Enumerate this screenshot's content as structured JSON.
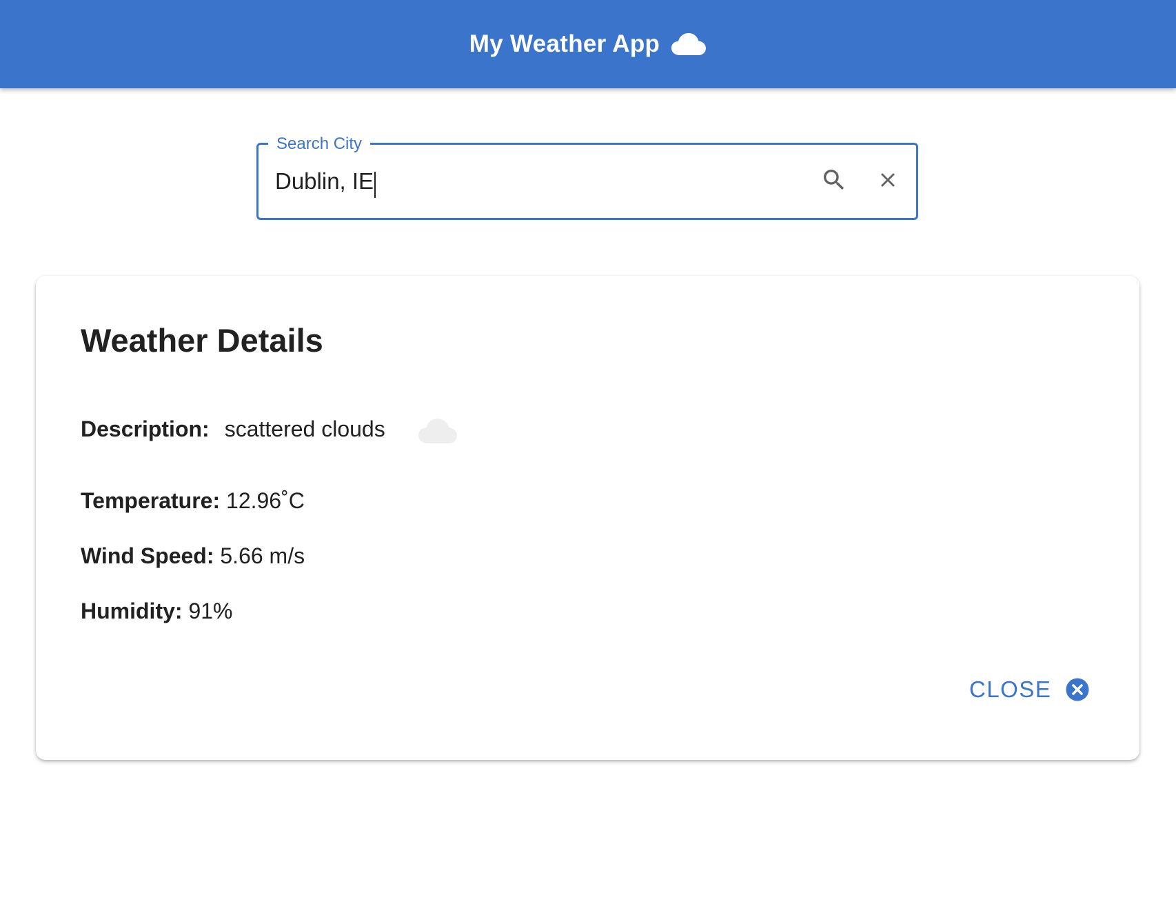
{
  "app_bar": {
    "title": "My Weather App",
    "icon": "cloud-icon",
    "background": "#3a75cb"
  },
  "search": {
    "label": "Search City",
    "value": "Dublin, IE",
    "search_icon": "search-icon",
    "clear_icon": "close-icon"
  },
  "card": {
    "title": "Weather Details",
    "description": {
      "label": "Description:",
      "value": "scattered clouds",
      "icon": "cloud-icon"
    },
    "temperature": {
      "label": "Temperature:",
      "value": "12.96˚C"
    },
    "wind_speed": {
      "label": "Wind Speed:",
      "value": "5.66 m/s"
    },
    "humidity": {
      "label": "Humidity:",
      "value": "91%"
    },
    "close_button": {
      "label": "CLOSE",
      "icon": "close-circle-icon"
    }
  },
  "colors": {
    "accent": "#3a75cb",
    "text": "#212121",
    "icon_gray": "#757575"
  }
}
